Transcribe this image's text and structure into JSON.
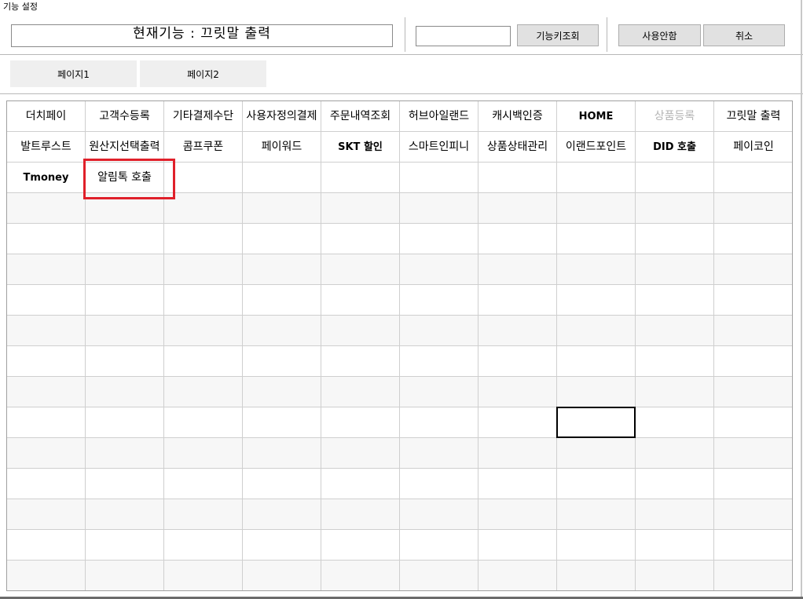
{
  "window": {
    "title": "기능 설정"
  },
  "header": {
    "current_function": "현재기능 : 끄릿말 출력",
    "key_input_value": "",
    "key_lookup_label": "기능키조회",
    "unused_label": "사용안함",
    "cancel_label": "취소"
  },
  "pages": {
    "page1": "페이지1",
    "page2": "페이지2"
  },
  "grid": {
    "rows": [
      [
        {
          "text": "더치페이"
        },
        {
          "text": "고객수등록"
        },
        {
          "text": "기타결제수단"
        },
        {
          "text": "사용자정의결제"
        },
        {
          "text": "주문내역조회"
        },
        {
          "text": "허브아일랜드"
        },
        {
          "text": "캐시백인증"
        },
        {
          "text": "HOME",
          "bold": true
        },
        {
          "text": "상품등록",
          "disabled": true
        },
        {
          "text": "끄릿말 출력"
        }
      ],
      [
        {
          "text": "발트루스트"
        },
        {
          "text": "원산지선택출력"
        },
        {
          "text": "콤프쿠폰"
        },
        {
          "text": "페이워드"
        },
        {
          "text": "SKT 할인",
          "bold": true
        },
        {
          "text": "스마트인피니"
        },
        {
          "text": "상품상태관리"
        },
        {
          "text": "이랜드포인트"
        },
        {
          "text": "DID 호출",
          "bold": true
        },
        {
          "text": "페이코인"
        }
      ],
      [
        {
          "text": "Tmoney",
          "bold": true
        },
        {
          "text": "알림톡 호출"
        }
      ]
    ]
  }
}
